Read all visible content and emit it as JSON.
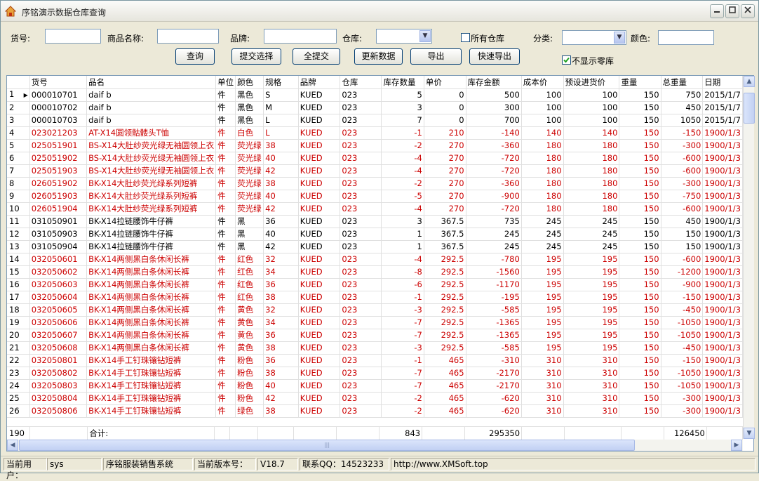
{
  "window": {
    "title": "序铭演示数据仓库查询",
    "min": "0",
    "max": "1",
    "close": "r"
  },
  "filters": {
    "goods_no_label": "货号:",
    "goods_no_value": "",
    "name_label": "商品名称:",
    "name_value": "",
    "brand_label": "品牌:",
    "brand_value": "",
    "warehouse_label": "仓库:",
    "warehouse_value": "",
    "all_warehouses_label": "所有仓库",
    "all_warehouses_checked": false,
    "category_label": "分类:",
    "category_value": "",
    "color_label": "颜色:",
    "color_value": "",
    "hide_zero_label": "不显示零库",
    "hide_zero_checked": true
  },
  "buttons": {
    "query": "查询",
    "submit_selected": "提交选择",
    "submit_all": "全提交",
    "refresh": "更新数据",
    "export": "导出",
    "quick_export": "快速导出"
  },
  "columns": [
    "",
    "货号",
    "品名",
    "单位",
    "颜色",
    "规格",
    "品牌",
    "仓库",
    "库存数量",
    "单价",
    "库存金额",
    "成本价",
    "预设进货价",
    "重量",
    "总重量",
    "日期"
  ],
  "rows": [
    {
      "n": "1",
      "code": "000010701",
      "name": "daif  b",
      "unit": "件",
      "color": "黑色",
      "size": "S",
      "brand": "KUED",
      "wh": "023",
      "qty": "5",
      "price": "0",
      "amount": "500",
      "cost": "100",
      "preset": "100",
      "weight": "150",
      "total": "750",
      "date": "2015/1/7",
      "red": false,
      "current": true
    },
    {
      "n": "2",
      "code": "000010702",
      "name": "daif  b",
      "unit": "件",
      "color": "黑色",
      "size": "M",
      "brand": "KUED",
      "wh": "023",
      "qty": "3",
      "price": "0",
      "amount": "300",
      "cost": "100",
      "preset": "100",
      "weight": "150",
      "total": "450",
      "date": "2015/1/7",
      "red": false
    },
    {
      "n": "3",
      "code": "000010703",
      "name": "daif  b",
      "unit": "件",
      "color": "黑色",
      "size": "L",
      "brand": "KUED",
      "wh": "023",
      "qty": "7",
      "price": "0",
      "amount": "700",
      "cost": "100",
      "preset": "100",
      "weight": "150",
      "total": "1050",
      "date": "2015/1/7",
      "red": false
    },
    {
      "n": "4",
      "code": "023021203",
      "name": "AT-X14圆领骷髅头T恤",
      "unit": "件",
      "color": "白色",
      "size": "L",
      "brand": "KUED",
      "wh": "023",
      "qty": "-1",
      "price": "210",
      "amount": "-140",
      "cost": "140",
      "preset": "140",
      "weight": "150",
      "total": "-150",
      "date": "1900/1/3",
      "red": true
    },
    {
      "n": "5",
      "code": "025051901",
      "name": "BS-X14大肚纱荧光绿无袖圆领上衣",
      "unit": "件",
      "color": "荧光绿",
      "size": "38",
      "brand": "KUED",
      "wh": "023",
      "qty": "-2",
      "price": "270",
      "amount": "-360",
      "cost": "180",
      "preset": "180",
      "weight": "150",
      "total": "-300",
      "date": "1900/1/3",
      "red": true
    },
    {
      "n": "6",
      "code": "025051902",
      "name": "BS-X14大肚纱荧光绿无袖圆领上衣",
      "unit": "件",
      "color": "荧光绿",
      "size": "40",
      "brand": "KUED",
      "wh": "023",
      "qty": "-4",
      "price": "270",
      "amount": "-720",
      "cost": "180",
      "preset": "180",
      "weight": "150",
      "total": "-600",
      "date": "1900/1/3",
      "red": true
    },
    {
      "n": "7",
      "code": "025051903",
      "name": "BS-X14大肚纱荧光绿无袖圆领上衣",
      "unit": "件",
      "color": "荧光绿",
      "size": "42",
      "brand": "KUED",
      "wh": "023",
      "qty": "-4",
      "price": "270",
      "amount": "-720",
      "cost": "180",
      "preset": "180",
      "weight": "150",
      "total": "-600",
      "date": "1900/1/3",
      "red": true
    },
    {
      "n": "8",
      "code": "026051902",
      "name": "BK-X14大肚纱荧光绿系列短裤",
      "unit": "件",
      "color": "荧光绿",
      "size": "38",
      "brand": "KUED",
      "wh": "023",
      "qty": "-2",
      "price": "270",
      "amount": "-360",
      "cost": "180",
      "preset": "180",
      "weight": "150",
      "total": "-300",
      "date": "1900/1/3",
      "red": true
    },
    {
      "n": "9",
      "code": "026051903",
      "name": "BK-X14大肚纱荧光绿系列短裤",
      "unit": "件",
      "color": "荧光绿",
      "size": "40",
      "brand": "KUED",
      "wh": "023",
      "qty": "-5",
      "price": "270",
      "amount": "-900",
      "cost": "180",
      "preset": "180",
      "weight": "150",
      "total": "-750",
      "date": "1900/1/3",
      "red": true
    },
    {
      "n": "10",
      "code": "026051904",
      "name": "BK-X14大肚纱荧光绿系列短裤",
      "unit": "件",
      "color": "荧光绿",
      "size": "42",
      "brand": "KUED",
      "wh": "023",
      "qty": "-4",
      "price": "270",
      "amount": "-720",
      "cost": "180",
      "preset": "180",
      "weight": "150",
      "total": "-600",
      "date": "1900/1/3",
      "red": true
    },
    {
      "n": "11",
      "code": "031050901",
      "name": "BK-X14拉链腰饰牛仔裤",
      "unit": "件",
      "color": "黑",
      "size": "36",
      "brand": "KUED",
      "wh": "023",
      "qty": "3",
      "price": "367.5",
      "amount": "735",
      "cost": "245",
      "preset": "245",
      "weight": "150",
      "total": "450",
      "date": "1900/1/3",
      "red": false
    },
    {
      "n": "12",
      "code": "031050903",
      "name": "BK-X14拉链腰饰牛仔裤",
      "unit": "件",
      "color": "黑",
      "size": "40",
      "brand": "KUED",
      "wh": "023",
      "qty": "1",
      "price": "367.5",
      "amount": "245",
      "cost": "245",
      "preset": "245",
      "weight": "150",
      "total": "150",
      "date": "1900/1/3",
      "red": false
    },
    {
      "n": "13",
      "code": "031050904",
      "name": "BK-X14拉链腰饰牛仔裤",
      "unit": "件",
      "color": "黑",
      "size": "42",
      "brand": "KUED",
      "wh": "023",
      "qty": "1",
      "price": "367.5",
      "amount": "245",
      "cost": "245",
      "preset": "245",
      "weight": "150",
      "total": "150",
      "date": "1900/1/3",
      "red": false
    },
    {
      "n": "14",
      "code": "032050601",
      "name": "BK-X14两侧黑白条休闲长裤",
      "unit": "件",
      "color": "红色",
      "size": "32",
      "brand": "KUED",
      "wh": "023",
      "qty": "-4",
      "price": "292.5",
      "amount": "-780",
      "cost": "195",
      "preset": "195",
      "weight": "150",
      "total": "-600",
      "date": "1900/1/3",
      "red": true
    },
    {
      "n": "15",
      "code": "032050602",
      "name": "BK-X14两侧黑白条休闲长裤",
      "unit": "件",
      "color": "红色",
      "size": "34",
      "brand": "KUED",
      "wh": "023",
      "qty": "-8",
      "price": "292.5",
      "amount": "-1560",
      "cost": "195",
      "preset": "195",
      "weight": "150",
      "total": "-1200",
      "date": "1900/1/3",
      "red": true
    },
    {
      "n": "16",
      "code": "032050603",
      "name": "BK-X14两侧黑白条休闲长裤",
      "unit": "件",
      "color": "红色",
      "size": "36",
      "brand": "KUED",
      "wh": "023",
      "qty": "-6",
      "price": "292.5",
      "amount": "-1170",
      "cost": "195",
      "preset": "195",
      "weight": "150",
      "total": "-900",
      "date": "1900/1/3",
      "red": true
    },
    {
      "n": "17",
      "code": "032050604",
      "name": "BK-X14两侧黑白条休闲长裤",
      "unit": "件",
      "color": "红色",
      "size": "38",
      "brand": "KUED",
      "wh": "023",
      "qty": "-1",
      "price": "292.5",
      "amount": "-195",
      "cost": "195",
      "preset": "195",
      "weight": "150",
      "total": "-150",
      "date": "1900/1/3",
      "red": true
    },
    {
      "n": "18",
      "code": "032050605",
      "name": "BK-X14两侧黑白条休闲长裤",
      "unit": "件",
      "color": "黄色",
      "size": "32",
      "brand": "KUED",
      "wh": "023",
      "qty": "-3",
      "price": "292.5",
      "amount": "-585",
      "cost": "195",
      "preset": "195",
      "weight": "150",
      "total": "-450",
      "date": "1900/1/3",
      "red": true
    },
    {
      "n": "19",
      "code": "032050606",
      "name": "BK-X14两侧黑白条休闲长裤",
      "unit": "件",
      "color": "黄色",
      "size": "34",
      "brand": "KUED",
      "wh": "023",
      "qty": "-7",
      "price": "292.5",
      "amount": "-1365",
      "cost": "195",
      "preset": "195",
      "weight": "150",
      "total": "-1050",
      "date": "1900/1/3",
      "red": true
    },
    {
      "n": "20",
      "code": "032050607",
      "name": "BK-X14两侧黑白条休闲长裤",
      "unit": "件",
      "color": "黄色",
      "size": "36",
      "brand": "KUED",
      "wh": "023",
      "qty": "-7",
      "price": "292.5",
      "amount": "-1365",
      "cost": "195",
      "preset": "195",
      "weight": "150",
      "total": "-1050",
      "date": "1900/1/3",
      "red": true
    },
    {
      "n": "21",
      "code": "032050608",
      "name": "BK-X14两侧黑白条休闲长裤",
      "unit": "件",
      "color": "黄色",
      "size": "38",
      "brand": "KUED",
      "wh": "023",
      "qty": "-3",
      "price": "292.5",
      "amount": "-585",
      "cost": "195",
      "preset": "195",
      "weight": "150",
      "total": "-450",
      "date": "1900/1/3",
      "red": true
    },
    {
      "n": "22",
      "code": "032050801",
      "name": "BK-X14手工钉珠镶钻短裤",
      "unit": "件",
      "color": "粉色",
      "size": "36",
      "brand": "KUED",
      "wh": "023",
      "qty": "-1",
      "price": "465",
      "amount": "-310",
      "cost": "310",
      "preset": "310",
      "weight": "150",
      "total": "-150",
      "date": "1900/1/3",
      "red": true
    },
    {
      "n": "23",
      "code": "032050802",
      "name": "BK-X14手工钉珠镶钻短裤",
      "unit": "件",
      "color": "粉色",
      "size": "38",
      "brand": "KUED",
      "wh": "023",
      "qty": "-7",
      "price": "465",
      "amount": "-2170",
      "cost": "310",
      "preset": "310",
      "weight": "150",
      "total": "-1050",
      "date": "1900/1/3",
      "red": true
    },
    {
      "n": "24",
      "code": "032050803",
      "name": "BK-X14手工钉珠镶钻短裤",
      "unit": "件",
      "color": "粉色",
      "size": "40",
      "brand": "KUED",
      "wh": "023",
      "qty": "-7",
      "price": "465",
      "amount": "-2170",
      "cost": "310",
      "preset": "310",
      "weight": "150",
      "total": "-1050",
      "date": "1900/1/3",
      "red": true
    },
    {
      "n": "25",
      "code": "032050804",
      "name": "BK-X14手工钉珠镶钻短裤",
      "unit": "件",
      "color": "粉色",
      "size": "42",
      "brand": "KUED",
      "wh": "023",
      "qty": "-2",
      "price": "465",
      "amount": "-620",
      "cost": "310",
      "preset": "310",
      "weight": "150",
      "total": "-300",
      "date": "1900/1/3",
      "red": true
    },
    {
      "n": "26",
      "code": "032050806",
      "name": "BK-X14手工钉珠镶钻短裤",
      "unit": "件",
      "color": "绿色",
      "size": "38",
      "brand": "KUED",
      "wh": "023",
      "qty": "-2",
      "price": "465",
      "amount": "-620",
      "cost": "310",
      "preset": "310",
      "weight": "150",
      "total": "-300",
      "date": "1900/1/3",
      "red": true
    }
  ],
  "totals": {
    "count": "190",
    "label": "合计:",
    "qty": "843",
    "amount": "295350",
    "total_weight": "126450"
  },
  "status": {
    "user_label": "当前用户：",
    "user": "sys",
    "system": "序铭服装销售系统",
    "version_label": "当前版本号：",
    "version": "V18.7",
    "qq": "联系QQ：14523233",
    "url": "http://www.XMSoft.top"
  },
  "colors": {
    "negative_row": "#cc0000",
    "accent": "#003c74"
  }
}
